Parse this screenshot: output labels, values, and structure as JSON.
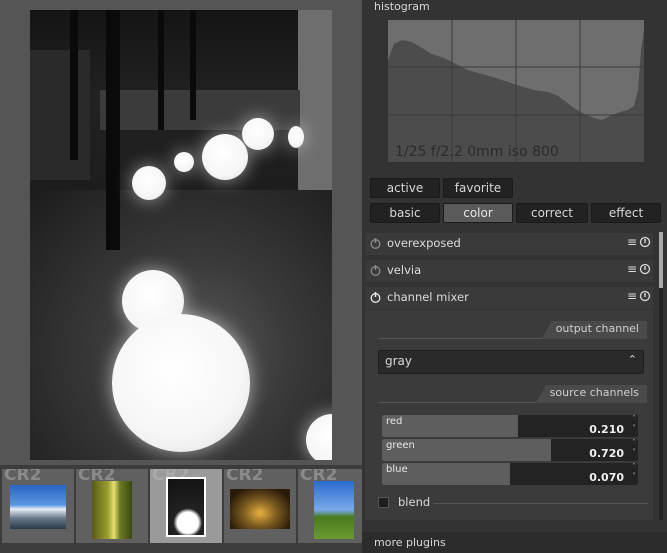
{
  "histogram": {
    "title": "histogram",
    "info": "1/25 f/2.2 0mm iso 800"
  },
  "group_tabs": {
    "active_label": "active",
    "favorite_label": "favorite",
    "basic_label": "basic",
    "color_label": "color",
    "correct_label": "correct",
    "effect_label": "effect",
    "selected": "color"
  },
  "modules": {
    "overexposed": {
      "label": "overexposed",
      "enabled": false
    },
    "velvia": {
      "label": "velvia",
      "enabled": false
    },
    "channel_mixer": {
      "label": "channel mixer",
      "enabled": true,
      "output_channel_label": "output channel",
      "output_channel_value": "gray",
      "source_channels_label": "source channels",
      "sliders": [
        {
          "label": "red",
          "value": "0.210",
          "fill": 0.53
        },
        {
          "label": "green",
          "value": "0.720",
          "fill": 0.66
        },
        {
          "label": "blue",
          "value": "0.070",
          "fill": 0.5
        }
      ],
      "blend_label": "blend"
    }
  },
  "footer": {
    "more_plugins": "more plugins"
  },
  "filmstrip": {
    "thumbnails": [
      {
        "ext": "CR2",
        "selected": false
      },
      {
        "ext": "CR2",
        "selected": false
      },
      {
        "ext": "CR2",
        "selected": true
      },
      {
        "ext": "CR2",
        "selected": false
      },
      {
        "ext": "CR2",
        "selected": false
      }
    ]
  },
  "icons": {
    "power": "power-icon",
    "menu": "hamburger-menu-icon",
    "reset": "reset-icon",
    "dropdown": "chevron-updown-icon"
  },
  "colors": {
    "panel_bg": "#333333",
    "histogram_bg": "#6e6e6e",
    "histogram_fill": "#4c4c4c",
    "selected_tab": "#5a5a5a"
  }
}
